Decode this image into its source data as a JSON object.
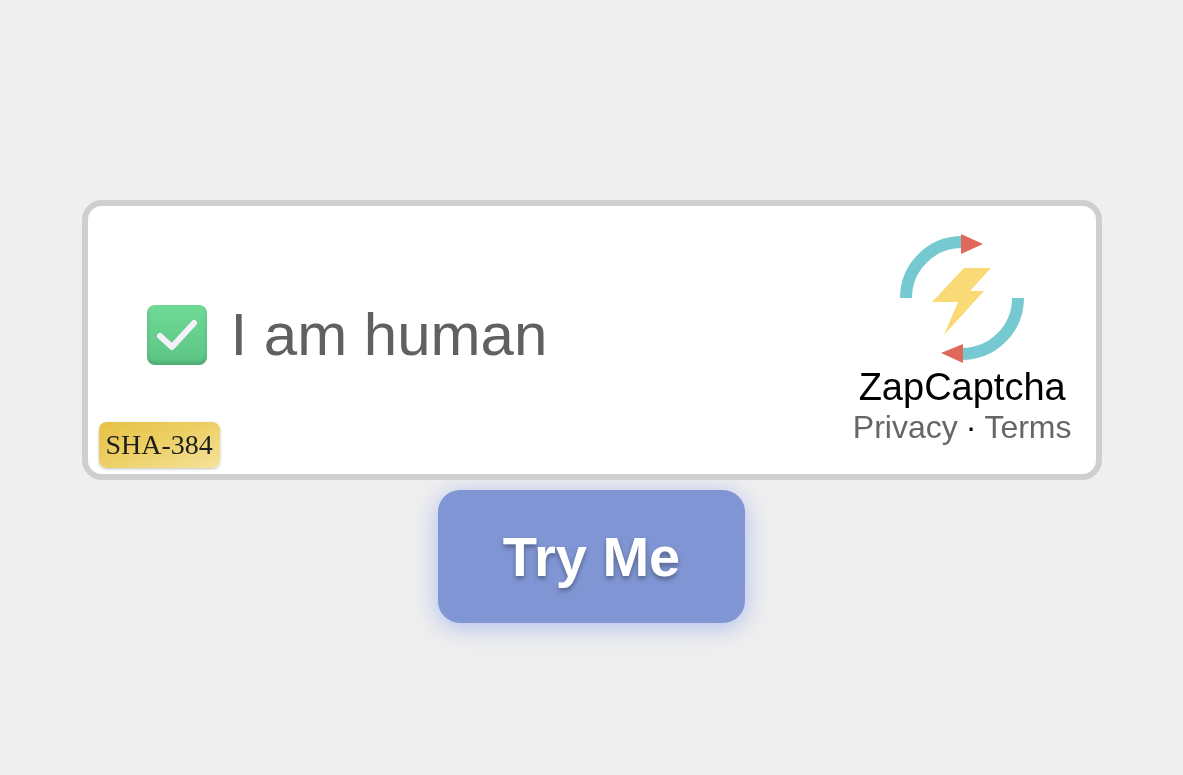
{
  "captcha": {
    "checkbox": {
      "checked": true
    },
    "label": "I am human",
    "hash_badge": "SHA-384",
    "brand": "ZapCaptcha",
    "links": [
      "Privacy",
      "Terms"
    ],
    "separator": "·"
  },
  "button": {
    "label": "Try Me"
  }
}
